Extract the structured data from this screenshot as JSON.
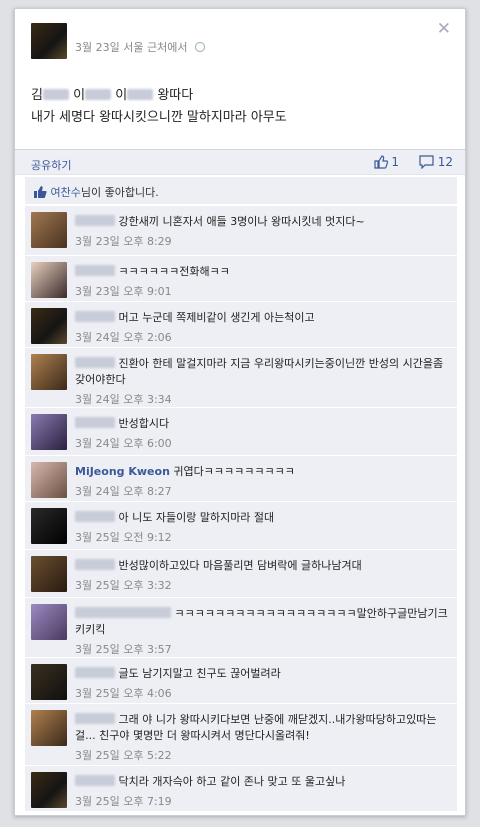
{
  "post": {
    "meta": "3월 23일 서울 근처에서",
    "line1_prefix": "김",
    "line1_mid1": "이",
    "line1_mid2": "이",
    "line1_end": "왕따다",
    "line2": "내가 세명다 왕따시킷으니깐 말하지마라 아무도"
  },
  "actions": {
    "share_label": "공유하기",
    "like_count": "1",
    "comment_count": "12"
  },
  "likes": {
    "name": "여찬수",
    "suffix": "님이 좋아합니다."
  },
  "comments": [
    {
      "text": "강한새끼 니혼자서 애들 3명이나 왕따시킷네 멋지다~",
      "time": "3월 23일 오후 8:29"
    },
    {
      "text": "ㅋㅋㅋㅋㅋㅋ전화해ㅋㅋ",
      "time": "3월 23일 오후 9:01"
    },
    {
      "text": "머고 누군데 쪽제비같이 생긴게 아는척이고",
      "time": "3월 24일 오후 2:06"
    },
    {
      "text": "진환아 한테 말걸지마라 지금 우리왕따시키는중이닌깐 반성의 시간을좀갖어야한다",
      "time": "3월 24일 오후 3:34"
    },
    {
      "text": "반성합시다",
      "time": "3월 24일 오후 6:00"
    },
    {
      "name": "MiJeong Kweon",
      "text": "귀엽다ㅋㅋㅋㅋㅋㅋㅋㅋㅋ",
      "time": "3월 24일 오후 8:27"
    },
    {
      "text": "아 니도 자들이랑 말하지마라 절대",
      "time": "3월 25일 오전 9:12"
    },
    {
      "text": "반성많이하고있다 마음풀리면 담벼락에 글하나남겨대",
      "time": "3월 25일 오후 3:32"
    },
    {
      "text": "ㅋㅋㅋㅋㅋㅋㅋㅋㅋㅋㅋㅋㅋㅋㅋㅋㅋㅋ말안하구글만남기크키키킥",
      "time": "3월 25일 오후 3:57"
    },
    {
      "text": "글도 남기지말고 친구도 끊어벌려라",
      "time": "3월 25일 오후 4:06"
    },
    {
      "text": "그래 야 니가 왕따시키다보면 난중에 깨닫겠지..내가왕따당하고있따는걸... 친구야 몇명만 더 왕따시켜서 명단다시올려줘!",
      "time": "3월 25일 오후 5:22"
    },
    {
      "text": "닥치라 개자슥아 하고 같이 존나 맞고 또 울고싶나",
      "time": "3월 25일 오후 7:19"
    }
  ],
  "colors": {
    "link": "#3b5998",
    "panel": "#edeff4"
  }
}
